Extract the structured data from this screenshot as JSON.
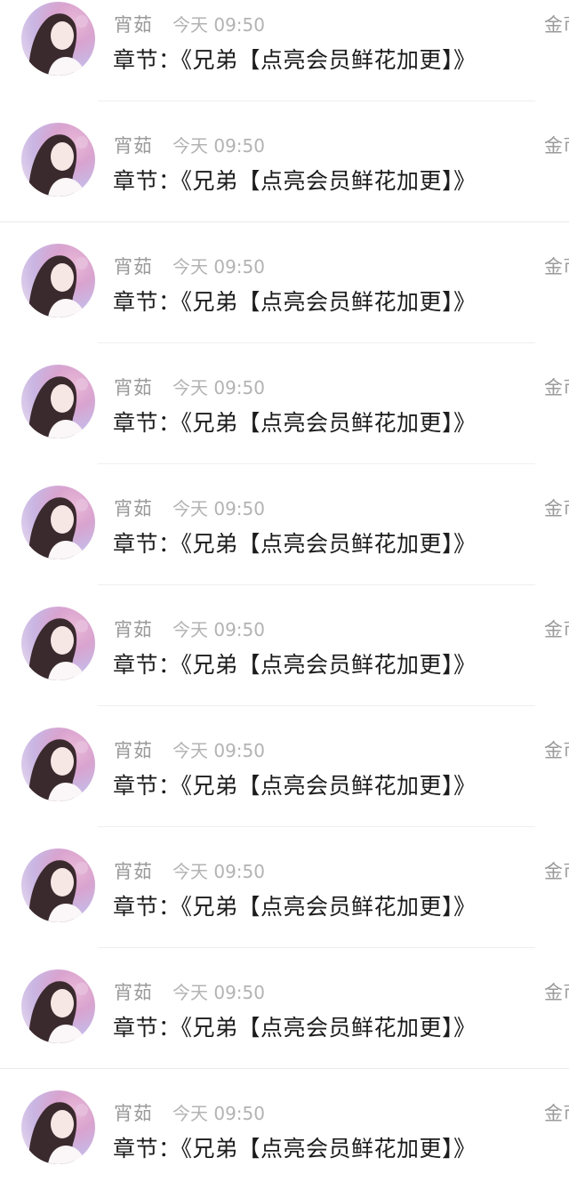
{
  "feed": {
    "items": [
      {
        "name": "宵茹",
        "time": "今天 09:50",
        "amount": "金币",
        "chapter": "章节：《兄弟【点亮会员鲜花加更】》"
      },
      {
        "name": "宵茹",
        "time": "今天 09:50",
        "amount": "金币",
        "chapter": "章节：《兄弟【点亮会员鲜花加更】》"
      },
      {
        "name": "宵茹",
        "time": "今天 09:50",
        "amount": "金币",
        "chapter": "章节：《兄弟【点亮会员鲜花加更】》"
      },
      {
        "name": "宵茹",
        "time": "今天 09:50",
        "amount": "金币",
        "chapter": "章节：《兄弟【点亮会员鲜花加更】》"
      },
      {
        "name": "宵茹",
        "time": "今天 09:50",
        "amount": "金币",
        "chapter": "章节：《兄弟【点亮会员鲜花加更】》"
      },
      {
        "name": "宵茹",
        "time": "今天 09:50",
        "amount": "金币",
        "chapter": "章节：《兄弟【点亮会员鲜花加更】》"
      },
      {
        "name": "宵茹",
        "time": "今天 09:50",
        "amount": "金币",
        "chapter": "章节：《兄弟【点亮会员鲜花加更】》"
      },
      {
        "name": "宵茹",
        "time": "今天 09:50",
        "amount": "金币",
        "chapter": "章节：《兄弟【点亮会员鲜花加更】》"
      },
      {
        "name": "宵茹",
        "time": "今天 09:50",
        "amount": "金币",
        "chapter": "章节：《兄弟【点亮会员鲜花加更】》"
      },
      {
        "name": "宵茹",
        "time": "今天 09:50",
        "amount": "金币",
        "chapter": "章节：《兄弟【点亮会员鲜花加更】》"
      }
    ]
  },
  "icons": {
    "avatar": "user-avatar-photo"
  }
}
